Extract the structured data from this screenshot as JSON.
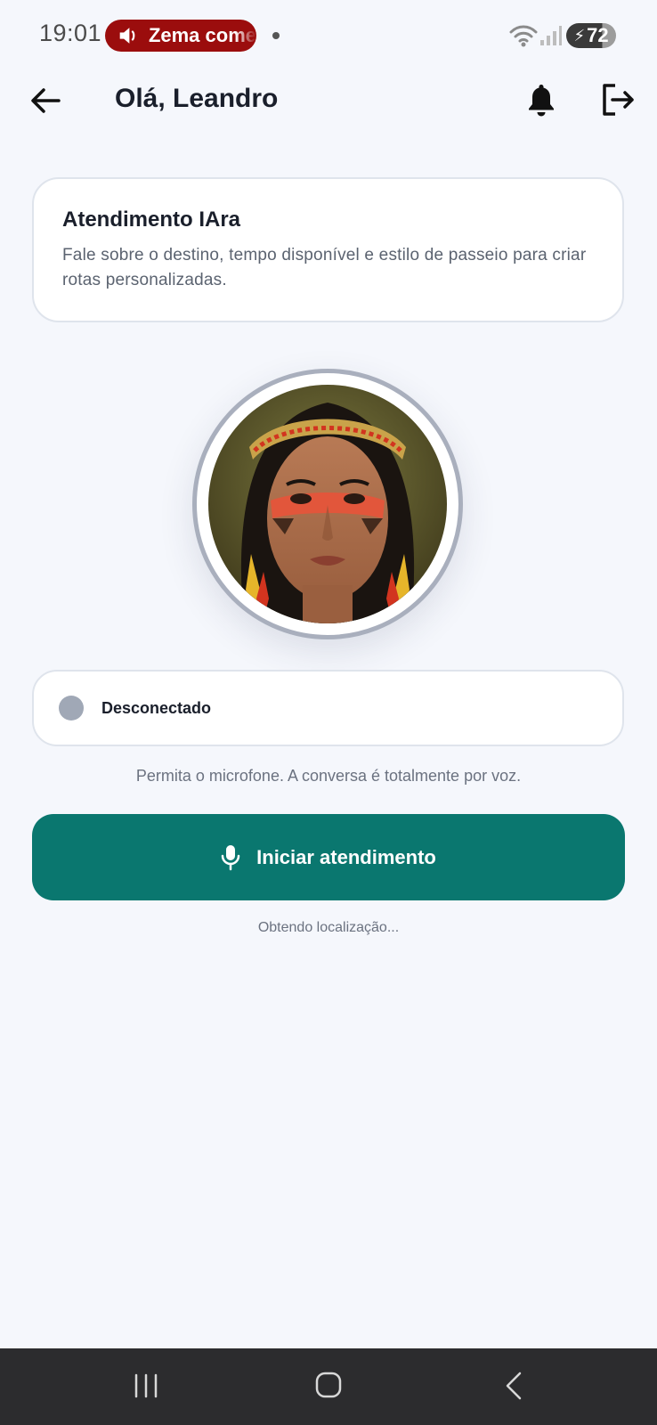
{
  "status_bar": {
    "time": "19:01",
    "media_label": "Zema come",
    "battery": "72"
  },
  "header": {
    "title": "Olá, Leandro"
  },
  "info_card": {
    "title": "Atendimento IAra",
    "description": "Fale sobre o destino, tempo disponível e estilo de passeio para criar rotas personalizadas."
  },
  "connection": {
    "status": "Desconectado",
    "indicator_color": "#a0a8b6"
  },
  "hint": "Permita o microfone. A conversa é totalmente por voz.",
  "start_button": {
    "label": "Iniciar atendimento",
    "color": "#0a776f"
  },
  "location_status": "Obtendo localização...",
  "icons": {
    "back": "arrow-left-icon",
    "notifications": "bell-icon",
    "logout": "logout-icon",
    "mic": "microphone-icon"
  }
}
